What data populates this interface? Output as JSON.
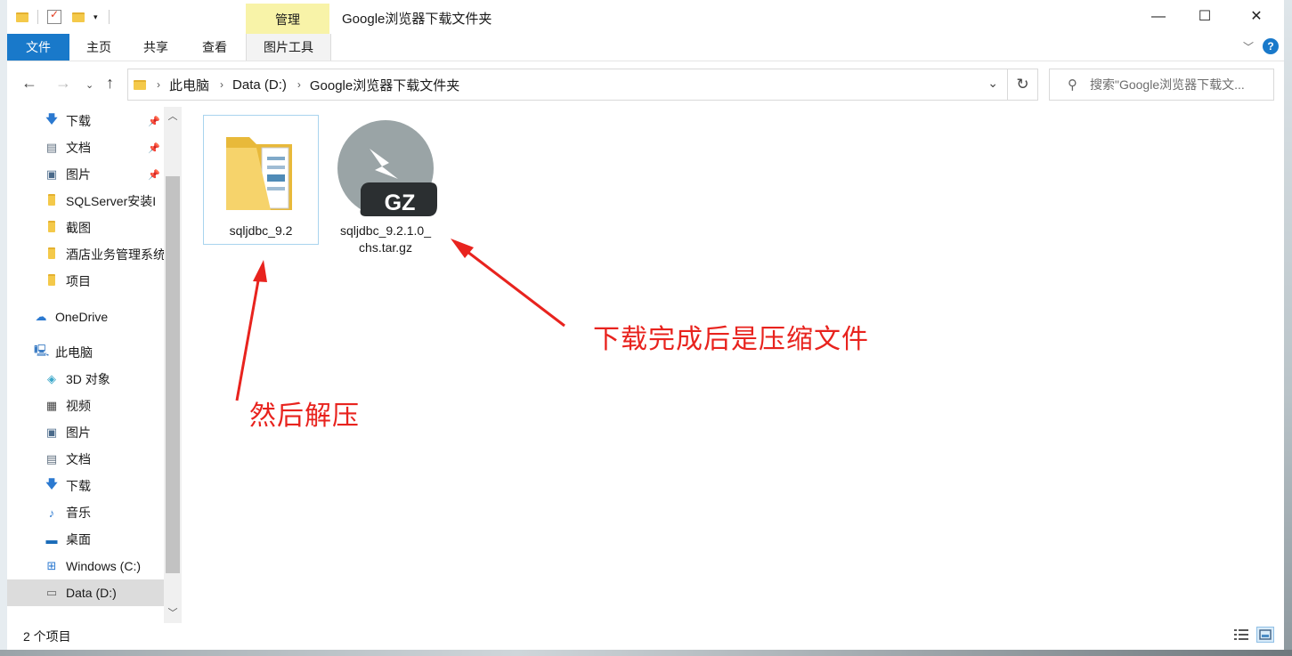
{
  "window": {
    "title": "Google浏览器下载文件夹",
    "context_tab_group": "管理",
    "controls": {
      "minimize": "—",
      "maximize": "☐",
      "close": "✕"
    }
  },
  "ribbon": {
    "tabs": [
      "文件",
      "主页",
      "共享",
      "查看",
      "图片工具"
    ],
    "active_tab_color": "#1979ca",
    "context_color": "#f8f3a8",
    "help": "?"
  },
  "address": {
    "crumbs": [
      "此电脑",
      "Data (D:)",
      "Google浏览器下载文件夹"
    ],
    "search_placeholder": "搜索\"Google浏览器下载文..."
  },
  "nav": {
    "quick_access": [
      {
        "label": "下载",
        "icon": "download-arrow-icon",
        "pinned": true
      },
      {
        "label": "文档",
        "icon": "document-icon",
        "pinned": true
      },
      {
        "label": "图片",
        "icon": "picture-icon",
        "pinned": true
      },
      {
        "label": "SQLServer安装I",
        "icon": "folder-icon",
        "pinned": false
      },
      {
        "label": "截图",
        "icon": "folder-icon",
        "pinned": false
      },
      {
        "label": "酒店业务管理系统",
        "icon": "folder-icon",
        "pinned": false
      },
      {
        "label": "项目",
        "icon": "folder-icon",
        "pinned": false
      }
    ],
    "onedrive": "OneDrive",
    "this_pc": "此电脑",
    "pc_items": [
      {
        "label": "3D 对象",
        "icon": "3d-objects-icon"
      },
      {
        "label": "视频",
        "icon": "video-icon"
      },
      {
        "label": "图片",
        "icon": "picture-icon"
      },
      {
        "label": "文档",
        "icon": "document-icon"
      },
      {
        "label": "下载",
        "icon": "download-arrow-icon"
      },
      {
        "label": "音乐",
        "icon": "music-icon"
      },
      {
        "label": "桌面",
        "icon": "desktop-icon"
      },
      {
        "label": "Windows (C:)",
        "icon": "drive-windows-icon"
      },
      {
        "label": "Data (D:)",
        "icon": "drive-icon",
        "selected": true
      }
    ]
  },
  "files": [
    {
      "name": "sqljdbc_9.2",
      "type": "folder",
      "selected": true
    },
    {
      "name_line1": "sqljdbc_9.2.1.0_",
      "name_line2": "chs.tar.gz",
      "type": "gz-archive",
      "badge": "GZ"
    }
  ],
  "annotations": {
    "compressed_note": "下载完成后是压缩文件",
    "extract_note": "然后解压",
    "color": "#e8231e"
  },
  "status": {
    "item_count": "2 个项目"
  }
}
